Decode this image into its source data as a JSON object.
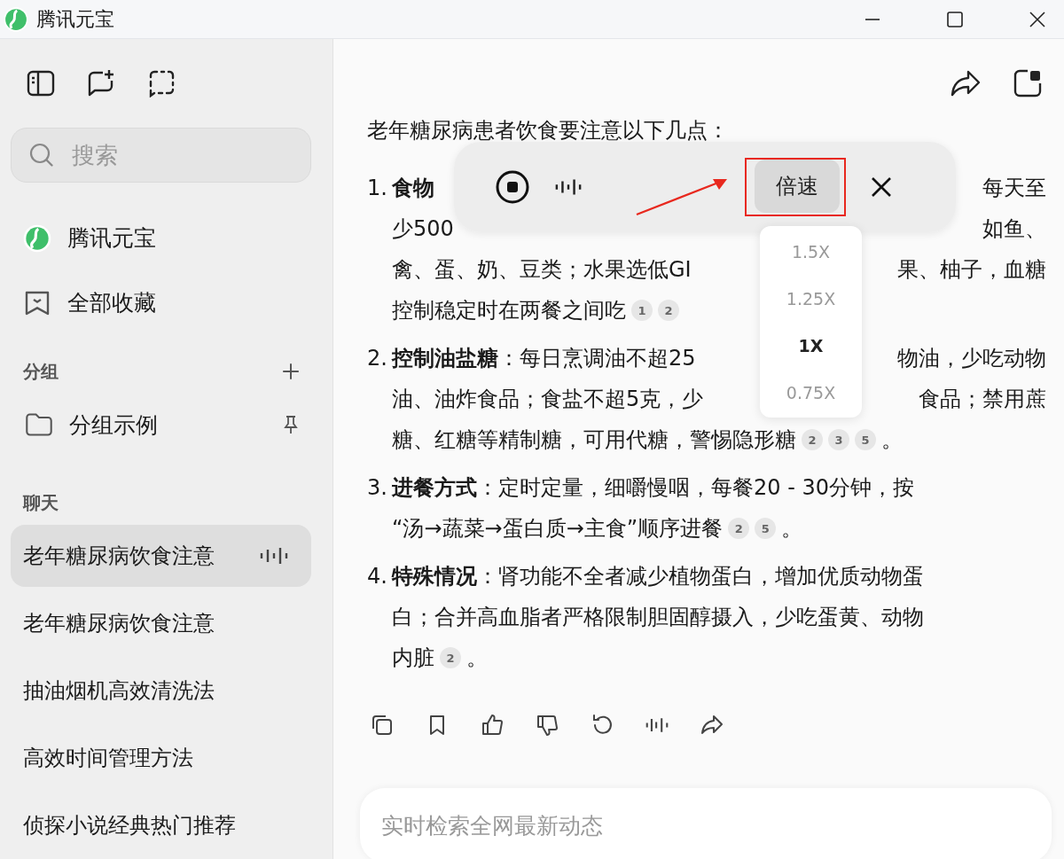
{
  "window": {
    "title": "腾讯元宝"
  },
  "sidebar": {
    "search": {
      "placeholder": "搜索"
    },
    "nav": [
      {
        "label": "腾讯元宝",
        "kind": "logo"
      },
      {
        "label": "全部收藏",
        "kind": "bookmark"
      }
    ],
    "groups": {
      "title": "分组",
      "items": [
        {
          "label": "分组示例"
        }
      ]
    },
    "chats": {
      "title": "聊天",
      "items": [
        {
          "label": "老年糖尿病饮食注意",
          "selected": true
        },
        {
          "label": "老年糖尿病饮食注意",
          "selected": false
        },
        {
          "label": "抽油烟机高效清洗法",
          "selected": false
        },
        {
          "label": "高效时间管理方法",
          "selected": false
        },
        {
          "label": "侦探小说经典热门推荐",
          "selected": false
        }
      ]
    }
  },
  "message": {
    "intro": "老年糖尿病患者饮食要注意以下几点：",
    "items": [
      {
        "number": "1.",
        "lines": [
          [
            [
              {
                "text": "**食物**"
              }
            ],
            [
              {
                "text": "每天至"
              }
            ]
          ],
          [
            [
              {
                "text": "少500"
              }
            ],
            [
              {
                "text": "如鱼、"
              }
            ]
          ],
          [
            [
              {
                "text": "禽、蛋、奶、豆类；水果选低GI"
              }
            ],
            [
              {
                "text": "果、柚子，血糖"
              }
            ]
          ],
          [
            [
              {
                "text": "控制稳定时在两餐之间吃"
              },
              {
                "cite": "1"
              },
              {
                "cite": "2"
              }
            ]
          ]
        ]
      },
      {
        "number": "2.",
        "lines": [
          [
            [
              {
                "text": "**控制油盐糖**：每日烹调油不超25"
              }
            ],
            [
              {
                "text": "物油，少吃动物"
              }
            ]
          ],
          [
            [
              {
                "text": "油、油炸食品；食盐不超5克，少"
              }
            ],
            [
              {
                "text": "食品；禁用蔗"
              }
            ]
          ],
          [
            [
              {
                "text": "糖、红糖等精制糖，可用代糖，警惕隐形糖"
              },
              {
                "cite": "2"
              },
              {
                "cite": "3"
              },
              {
                "cite": "5"
              },
              {
                "text": "。"
              }
            ]
          ]
        ]
      },
      {
        "number": "3.",
        "lines": [
          [
            [
              {
                "text": "**进餐方式**：定时定量，细嚼慢咽，每餐20 - 30分钟，按"
              }
            ]
          ],
          [
            [
              {
                "text": "“汤→蔬菜→蛋白质→主食”顺序进餐"
              },
              {
                "cite": "2"
              },
              {
                "cite": "5"
              },
              {
                "text": "。"
              }
            ]
          ]
        ]
      },
      {
        "number": "4.",
        "lines": [
          [
            [
              {
                "text": "**特殊情况**：肾功能不全者减少植物蛋白，增加优质动物蛋"
              }
            ]
          ],
          [
            [
              {
                "text": "白；合并高血脂者严格限制胆固醇摄入，少吃蛋黄、动物"
              }
            ]
          ],
          [
            [
              {
                "text": "内脏"
              },
              {
                "cite": "2"
              },
              {
                "text": "。"
              }
            ]
          ]
        ]
      }
    ]
  },
  "player": {
    "speed_label": "倍速",
    "speed_options": [
      {
        "label": "1.5X",
        "selected": false
      },
      {
        "label": "1.25X",
        "selected": false
      },
      {
        "label": "1X",
        "selected": true
      },
      {
        "label": "0.75X",
        "selected": false
      }
    ]
  },
  "composer": {
    "placeholder": "实时检索全网最新动态"
  }
}
